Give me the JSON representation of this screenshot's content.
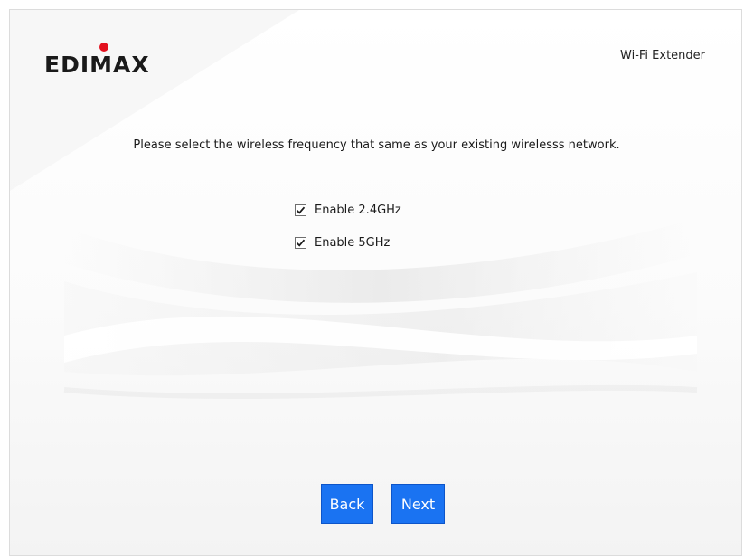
{
  "header": {
    "brand": "EDIMAX",
    "product_name": "Wi-Fi Extender"
  },
  "main": {
    "prompt": "Please select the wireless frequency that same as your existing wirelesss network.",
    "options": [
      {
        "label": "Enable 2.4GHz",
        "checked": true
      },
      {
        "label": "Enable 5GHz",
        "checked": true
      }
    ]
  },
  "buttons": {
    "back_label": "Back",
    "next_label": "Next"
  },
  "colors": {
    "button": "#1a73f2",
    "logo_dot": "#e3101e",
    "logo_text": "#1a1a1a"
  }
}
